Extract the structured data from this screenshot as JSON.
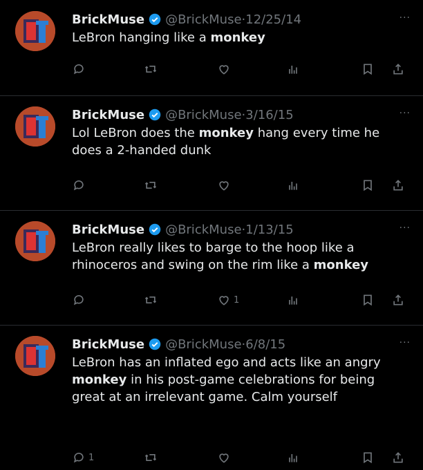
{
  "tweets": [
    {
      "name": "BrickMuse",
      "handle": "@BrickMuse",
      "date": "12/25/14",
      "text_segments": [
        {
          "t": "LeBron hanging like a ",
          "b": false
        },
        {
          "t": "monkey",
          "b": true
        }
      ],
      "reply_count": "",
      "like_count": ""
    },
    {
      "name": "BrickMuse",
      "handle": "@BrickMuse",
      "date": "3/16/15",
      "text_segments": [
        {
          "t": "Lol LeBron does the ",
          "b": false
        },
        {
          "t": "monkey",
          "b": true
        },
        {
          "t": " hang every time he does a 2-handed dunk",
          "b": false
        }
      ],
      "reply_count": "",
      "like_count": ""
    },
    {
      "name": "BrickMuse",
      "handle": "@BrickMuse",
      "date": "1/13/15",
      "text_segments": [
        {
          "t": "LeBron really likes to barge to the hoop like a rhinoceros and swing on the rim like a ",
          "b": false
        },
        {
          "t": "monkey",
          "b": true
        }
      ],
      "reply_count": "",
      "like_count": "1"
    },
    {
      "name": "BrickMuse",
      "handle": "@BrickMuse",
      "date": "6/8/15",
      "text_segments": [
        {
          "t": "LeBron has an inflated ego and acts like an angry ",
          "b": false
        },
        {
          "t": "monkey",
          "b": true
        },
        {
          "t": " in his post-game celebrations for being great at an irrelevant game. Calm yourself",
          "b": false
        }
      ],
      "reply_count": "1",
      "like_count": ""
    }
  ],
  "separator": "·",
  "more_glyph": "···",
  "colors": {
    "background": "#000000",
    "text": "#e7e9ea",
    "muted": "#71767b",
    "verified": "#1d9bf0",
    "avatar_bg": "#b84a2a"
  },
  "icons": [
    "reply-icon",
    "retweet-icon",
    "like-icon",
    "views-icon",
    "bookmark-icon",
    "share-icon",
    "verified-badge-icon",
    "more-icon"
  ]
}
